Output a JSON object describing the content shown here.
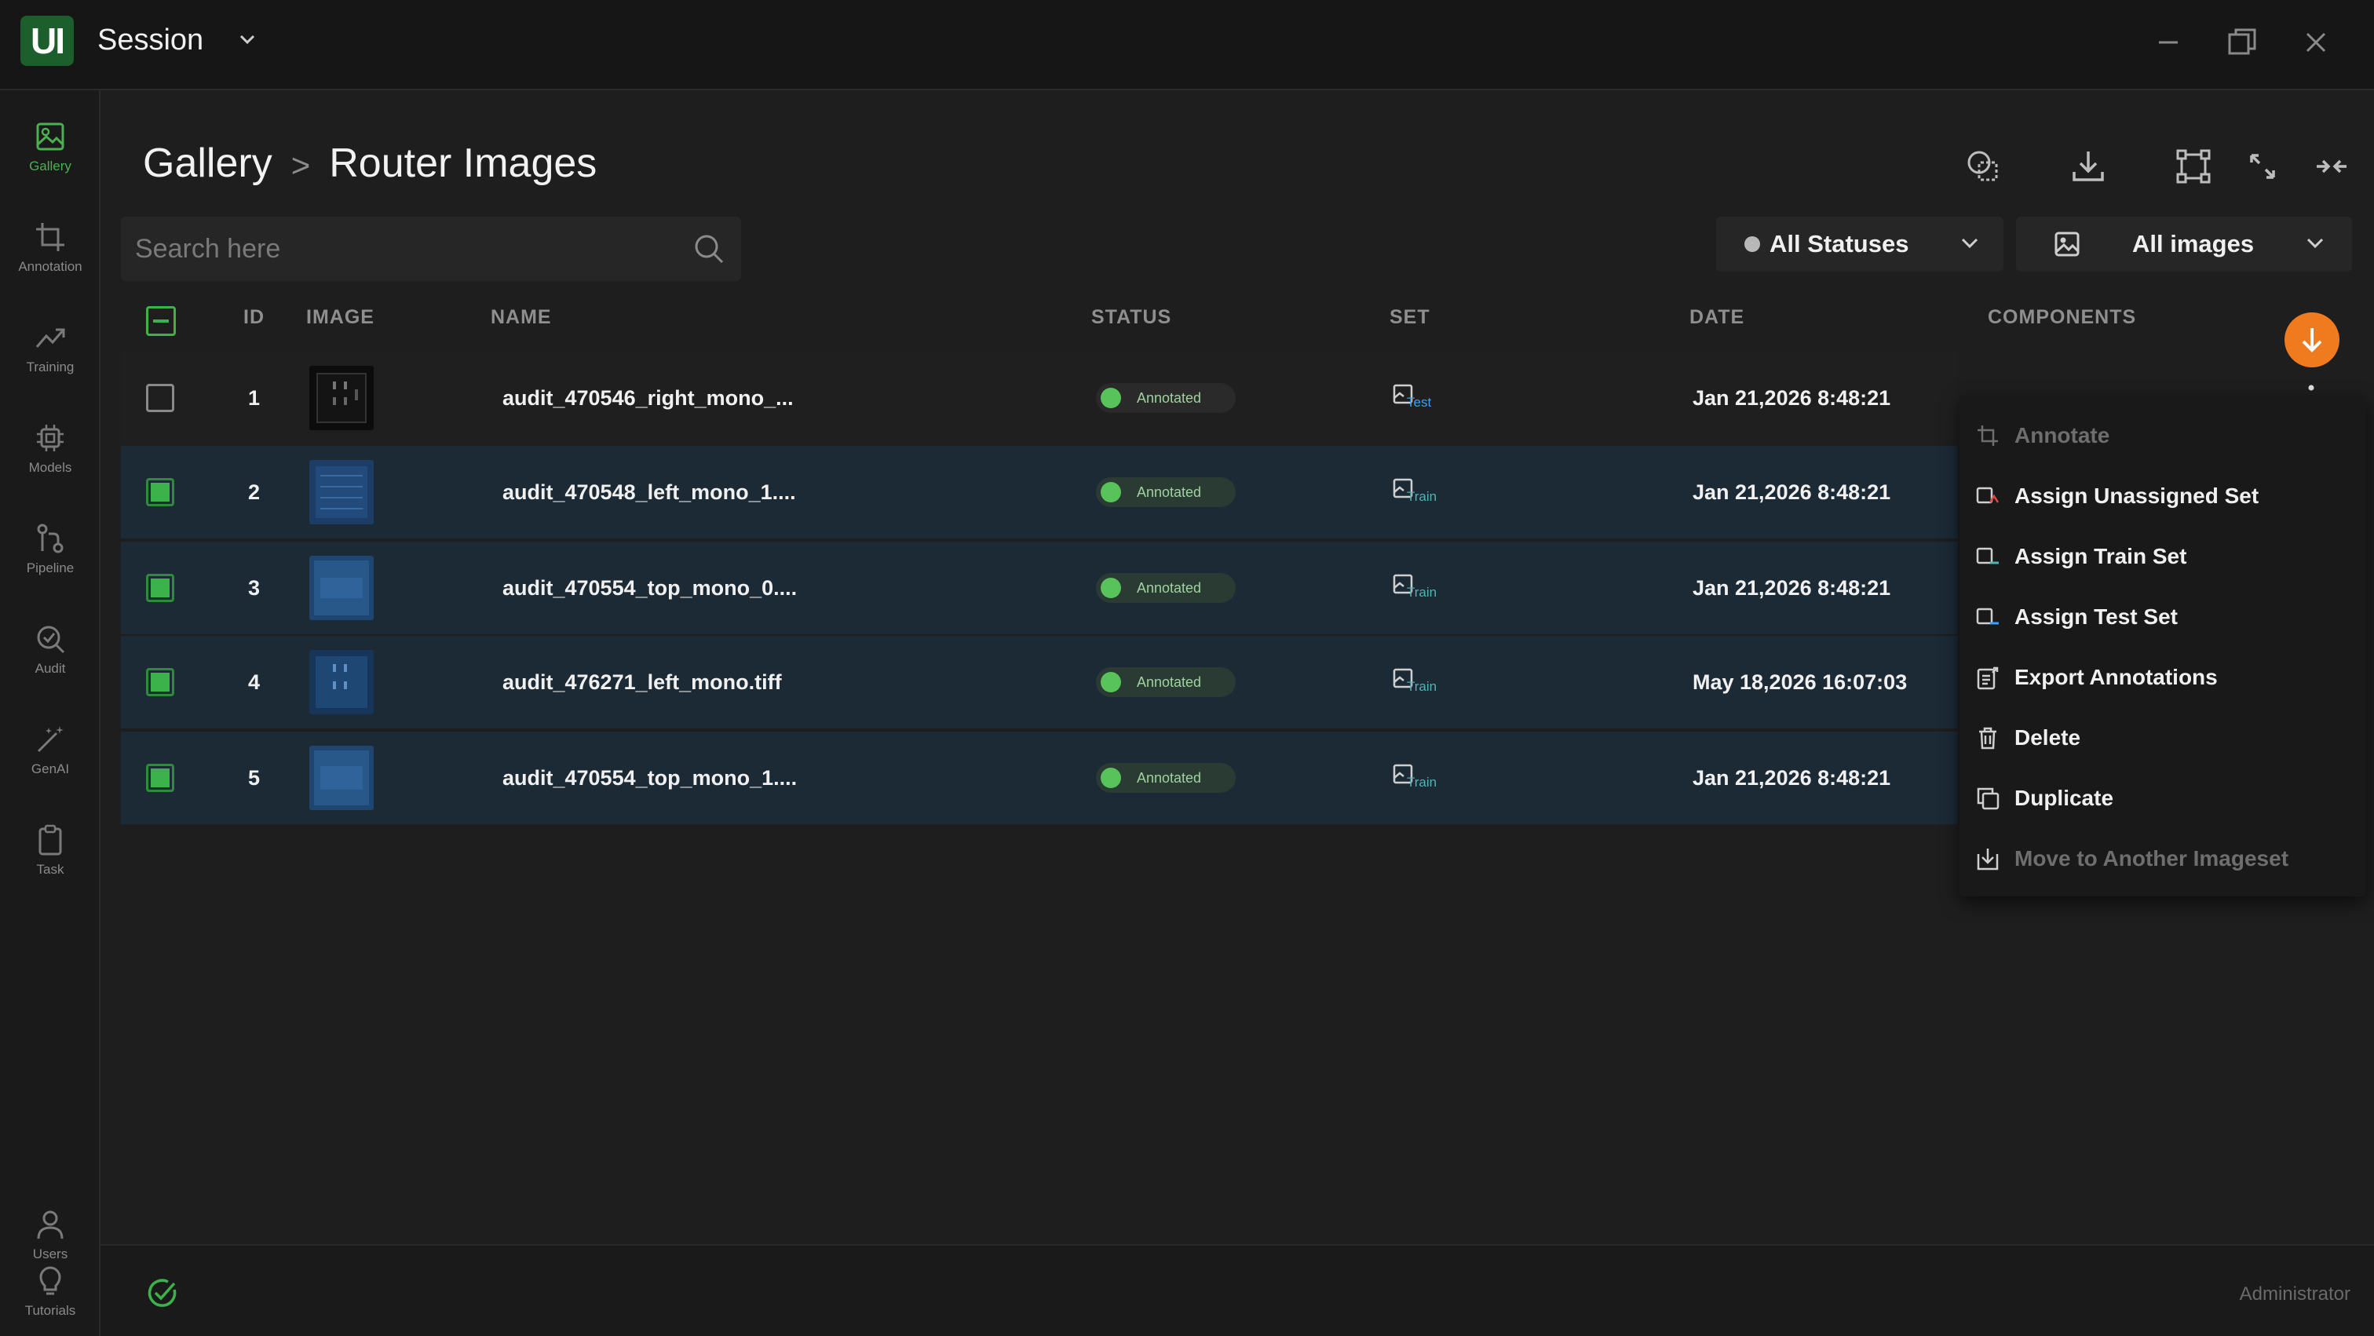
{
  "app": {
    "logo_text": "UI",
    "session_title": "Session"
  },
  "sidebar": {
    "items": [
      {
        "label": "Gallery",
        "icon": "gallery-icon",
        "active": true
      },
      {
        "label": "Annotation",
        "icon": "crop-icon",
        "active": false
      },
      {
        "label": "Training",
        "icon": "trend-icon",
        "active": false
      },
      {
        "label": "Models",
        "icon": "chip-icon",
        "active": false
      },
      {
        "label": "Pipeline",
        "icon": "pipeline-icon",
        "active": false
      },
      {
        "label": "Audit",
        "icon": "audit-icon",
        "active": false
      },
      {
        "label": "GenAI",
        "icon": "wand-icon",
        "active": false
      },
      {
        "label": "Task",
        "icon": "clipboard-icon",
        "active": false
      }
    ],
    "bottom_items": [
      {
        "label": "Users",
        "icon": "user-icon"
      },
      {
        "label": "Tutorials",
        "icon": "bulb-icon"
      }
    ]
  },
  "header": {
    "breadcrumb_root": "Gallery",
    "breadcrumb_sep": ">",
    "breadcrumb_current": "Router Images"
  },
  "search": {
    "placeholder": "Search here",
    "value": ""
  },
  "filters": {
    "status": "All Statuses",
    "images": "All images"
  },
  "table": {
    "columns": [
      "ID",
      "IMAGE",
      "NAME",
      "STATUS",
      "SET",
      "DATE",
      "COMPONENTS"
    ],
    "rows": [
      {
        "id": "1",
        "name": "audit_470546_right_mono_...",
        "status": "Annotated",
        "set": "Test",
        "date": "Jan 21,2026 8:48:21",
        "selected": false
      },
      {
        "id": "2",
        "name": "audit_470548_left_mono_1....",
        "status": "Annotated",
        "set": "Train",
        "date": "Jan 21,2026 8:48:21",
        "selected": true
      },
      {
        "id": "3",
        "name": "audit_470554_top_mono_0....",
        "status": "Annotated",
        "set": "Train",
        "date": "Jan 21,2026 8:48:21",
        "selected": true
      },
      {
        "id": "4",
        "name": "audit_476271_left_mono.tiff",
        "status": "Annotated",
        "set": "Train",
        "date": "May 18,2026 16:07:03",
        "selected": true
      },
      {
        "id": "5",
        "name": "audit_470554_top_mono_1....",
        "status": "Annotated",
        "set": "Train",
        "date": "Jan 21,2026 8:48:21",
        "selected": true
      }
    ]
  },
  "context_menu": {
    "items": [
      {
        "label": "Annotate",
        "disabled": true
      },
      {
        "label": "Assign Unassigned Set",
        "disabled": false
      },
      {
        "label": "Assign Train Set",
        "disabled": false
      },
      {
        "label": "Assign Test Set",
        "disabled": false
      },
      {
        "label": "Export Annotations",
        "disabled": false
      },
      {
        "label": "Delete",
        "disabled": false
      },
      {
        "label": "Duplicate",
        "disabled": false
      },
      {
        "label": "Move to Another Imageset",
        "disabled": true
      }
    ]
  },
  "footer": {
    "user_role": "Administrator"
  },
  "colors": {
    "accent_green": "#4caf50",
    "selected_row": "#1c2a36",
    "fab_orange": "#f07a1e",
    "test_set_blue": "#3aa0ff",
    "train_set_teal": "#4fb3b3"
  }
}
